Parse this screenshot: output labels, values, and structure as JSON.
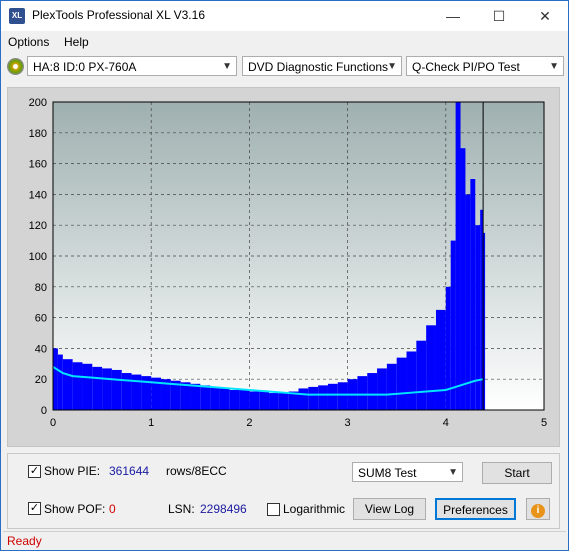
{
  "app": {
    "title": "PlexTools Professional XL V3.16",
    "icon_text": "XL"
  },
  "window_controls": {
    "minimize": "—",
    "maximize": "☐",
    "close": "✕"
  },
  "menu": {
    "items": [
      "Options",
      "Help"
    ]
  },
  "toolbar": {
    "drive": "HA:8 ID:0  PX-760A",
    "function": "DVD Diagnostic Functions",
    "test": "Q-Check PI/PO Test"
  },
  "chart_data": {
    "type": "bar",
    "xlabel": "",
    "ylabel": "",
    "xlim": [
      0,
      5
    ],
    "ylim": [
      0,
      200
    ],
    "x_ticks": [
      "0",
      "1",
      "2",
      "3",
      "4",
      "5"
    ],
    "y_ticks": [
      "0",
      "20",
      "40",
      "60",
      "80",
      "100",
      "120",
      "140",
      "160",
      "180",
      "200"
    ],
    "grid": true,
    "end_marker_x": 4.38,
    "series": [
      {
        "kind": "pie_bars",
        "color": "#0000ff",
        "x": [
          0.0,
          0.05,
          0.1,
          0.2,
          0.3,
          0.4,
          0.5,
          0.6,
          0.7,
          0.8,
          0.9,
          1.0,
          1.1,
          1.2,
          1.3,
          1.4,
          1.5,
          1.6,
          1.7,
          1.8,
          1.9,
          2.0,
          2.1,
          2.2,
          2.3,
          2.4,
          2.5,
          2.6,
          2.7,
          2.8,
          2.9,
          3.0,
          3.1,
          3.2,
          3.3,
          3.4,
          3.5,
          3.6,
          3.7,
          3.8,
          3.9,
          4.0,
          4.05,
          4.1,
          4.15,
          4.2,
          4.25,
          4.3,
          4.35,
          4.38
        ],
        "y": [
          40,
          36,
          33,
          31,
          30,
          28,
          27,
          26,
          24,
          23,
          22,
          21,
          20,
          19,
          18,
          17,
          16,
          15,
          14,
          13,
          13,
          12,
          12,
          11,
          11,
          12,
          14,
          15,
          16,
          17,
          18,
          20,
          22,
          24,
          27,
          30,
          34,
          38,
          45,
          55,
          65,
          80,
          110,
          200,
          170,
          140,
          150,
          120,
          130,
          115
        ]
      },
      {
        "kind": "sum8_line",
        "color": "#00e5ff",
        "x": [
          0.0,
          0.1,
          0.2,
          0.4,
          0.6,
          0.8,
          1.0,
          1.2,
          1.4,
          1.6,
          1.8,
          2.0,
          2.2,
          2.4,
          2.6,
          2.8,
          3.0,
          3.2,
          3.4,
          3.6,
          3.8,
          4.0,
          4.1,
          4.2,
          4.3,
          4.38
        ],
        "y": [
          28,
          24,
          22,
          21,
          20,
          19,
          18,
          17,
          16,
          15,
          14,
          13,
          12,
          11,
          10,
          10,
          10,
          10,
          10,
          11,
          12,
          13,
          15,
          17,
          19,
          20
        ]
      }
    ]
  },
  "controls": {
    "show_pie_label": "Show PIE:",
    "pie_value": "361644",
    "rows_label": "rows/8ECC",
    "test_select": "SUM8 Test",
    "start_label": "Start",
    "show_pof_label": "Show POF:",
    "pof_value": "0",
    "lsn_label": "LSN:",
    "lsn_value": "2298496",
    "log_label": "Logarithmic",
    "view_log_label": "View Log",
    "preferences_label": "Preferences",
    "pie_checked": "✓",
    "pof_checked": "✓"
  },
  "status": {
    "text": "Ready"
  }
}
